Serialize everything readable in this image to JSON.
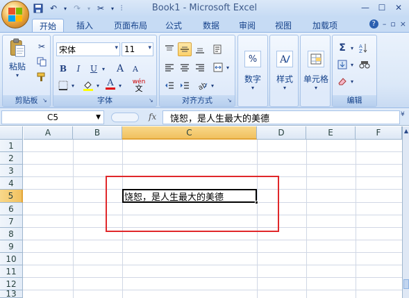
{
  "window": {
    "title": "Book1 - Microsoft Excel"
  },
  "qat": {
    "save_icon": "save-icon",
    "undo_icon": "undo-icon",
    "redo_icon": "redo-icon"
  },
  "tabs": [
    {
      "label": "开始",
      "active": true
    },
    {
      "label": "插入"
    },
    {
      "label": "页面布局"
    },
    {
      "label": "公式"
    },
    {
      "label": "数据"
    },
    {
      "label": "审阅"
    },
    {
      "label": "视图"
    },
    {
      "label": "加载项"
    }
  ],
  "ribbon": {
    "clipboard": {
      "label": "剪贴板",
      "paste_label": "粘贴"
    },
    "font": {
      "label": "字体",
      "font_name": "宋体",
      "font_size": "11",
      "bold": "B",
      "italic": "I",
      "underline": "U",
      "grow": "A",
      "shrink": "A",
      "color_letter": "A",
      "wen": "wén",
      "wen_sub": "文"
    },
    "alignment": {
      "label": "对齐方式"
    },
    "number": {
      "label": "数字",
      "percent": "%"
    },
    "styles": {
      "label": "样式"
    },
    "cells": {
      "label": "单元格"
    },
    "editing": {
      "label": "编辑",
      "sigma": "Σ"
    }
  },
  "formula_bar": {
    "name_box": "C5",
    "fx": "fx",
    "content": "饶恕，是人生最大的美德"
  },
  "sheet": {
    "columns": [
      "A",
      "B",
      "C",
      "D",
      "E",
      "F"
    ],
    "rows": [
      "1",
      "2",
      "3",
      "4",
      "5",
      "6",
      "7",
      "8",
      "9",
      "10",
      "11",
      "12",
      "13"
    ],
    "active_column": "C",
    "active_row": "5",
    "active_cell_text": "饶恕，是人生最大的美德"
  },
  "colors": {
    "accent": "#15428b",
    "highlight_box": "#e0272a",
    "active_header": "#f1c15f"
  }
}
